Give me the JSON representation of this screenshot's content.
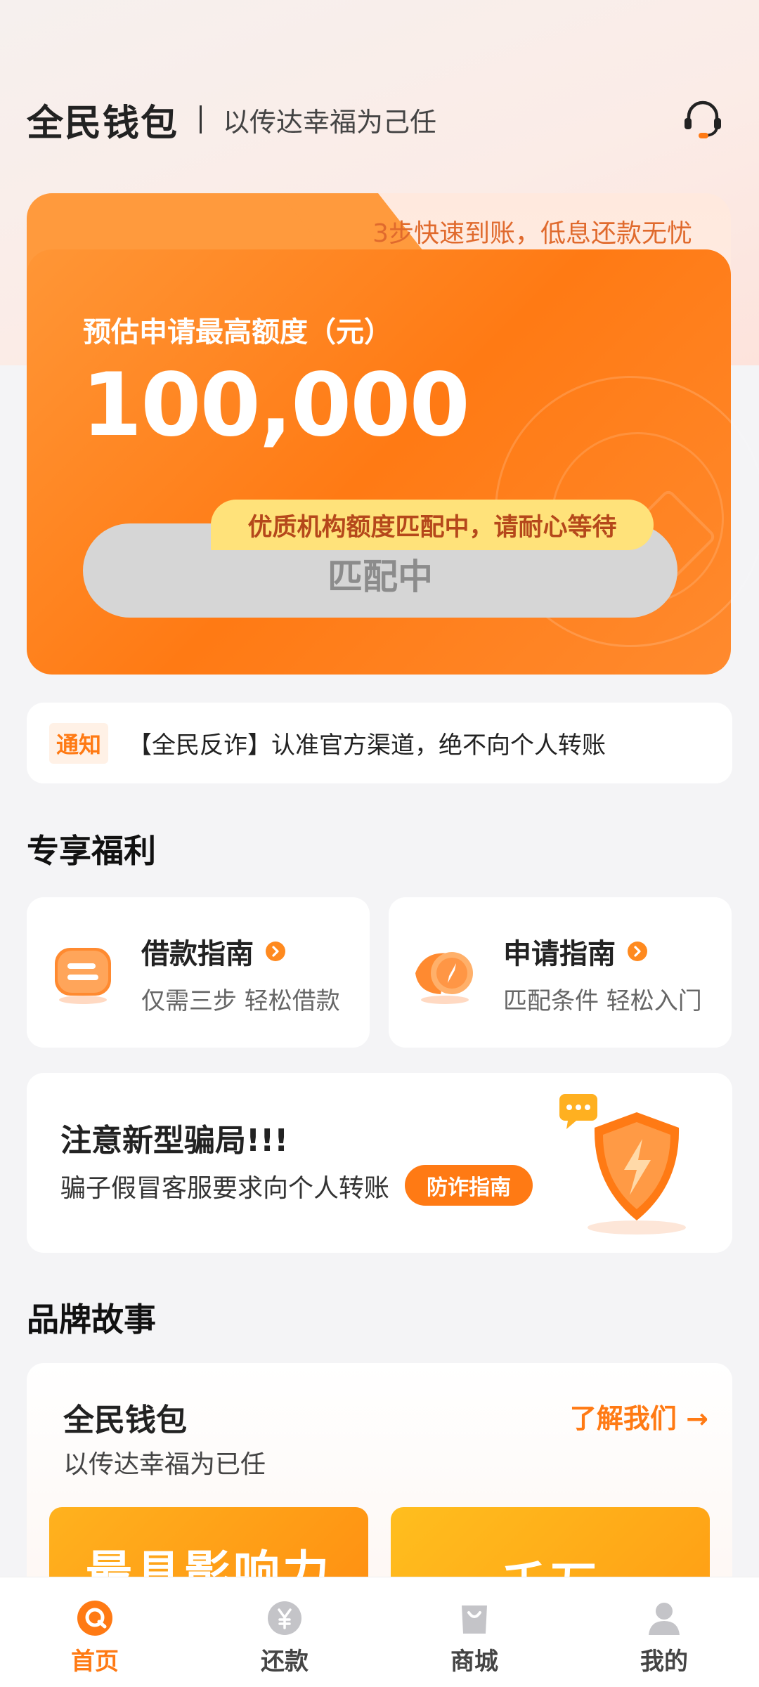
{
  "header": {
    "brand": "全民钱包",
    "slogan": "以传达幸福为己任"
  },
  "loan_card": {
    "tag": "3步快速到账，低息还款无忧",
    "limit_label": "预估申请最高额度（元）",
    "limit_amount": "100,000",
    "match_button": "匹配中",
    "match_tip": "优质机构额度匹配中，请耐心等待"
  },
  "notice": {
    "badge": "通知",
    "text": "【全民反诈】认准官方渠道，绝不向个人转账"
  },
  "benefits": {
    "title": "专享福利",
    "items": [
      {
        "title": "借款指南",
        "subtitle": "仅需三步 轻松借款"
      },
      {
        "title": "申请指南",
        "subtitle": "匹配条件 轻松入门"
      }
    ]
  },
  "fraud": {
    "title": "注意新型骗局!!!",
    "desc": "骗子假冒客服要求向个人转账",
    "button": "防诈指南"
  },
  "story": {
    "section_title": "品牌故事",
    "title": "全民钱包",
    "subtitle": "以传达幸福为已任",
    "link": "了解我们 →",
    "tiles": [
      "最具影响力",
      "千万"
    ]
  },
  "nav": {
    "items": [
      {
        "label": "首页",
        "active": true
      },
      {
        "label": "还款",
        "active": false
      },
      {
        "label": "商城",
        "active": false
      },
      {
        "label": "我的",
        "active": false
      }
    ]
  },
  "colors": {
    "accent": "#ff7a14",
    "tip_bg": "#ffe27a"
  }
}
